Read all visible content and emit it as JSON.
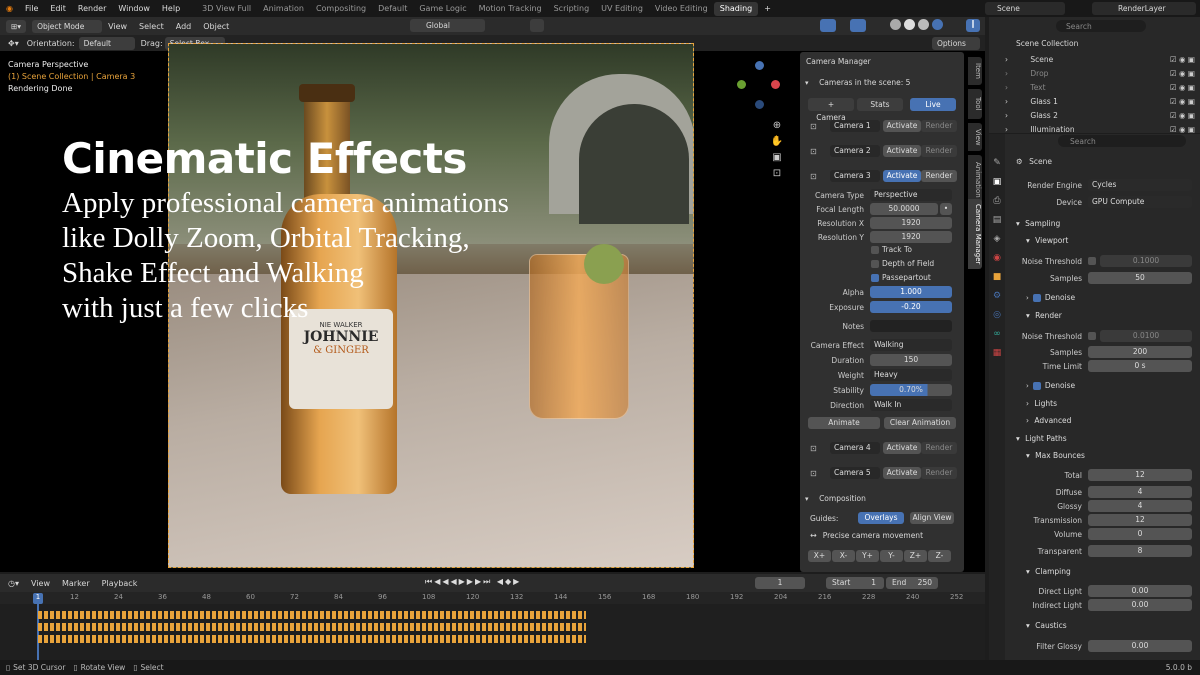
{
  "menu": {
    "items": [
      "File",
      "Edit",
      "Render",
      "Window",
      "Help"
    ],
    "workspaces": [
      "3D View Full",
      "Animation",
      "Compositing",
      "Default",
      "Game Logic",
      "Motion Tracking",
      "Scripting",
      "UV Editing",
      "Video Editing",
      "Shading"
    ],
    "scene": "Scene",
    "renderlayer": "RenderLayer"
  },
  "viewport_header": {
    "mode": "Object Mode",
    "menus": [
      "View",
      "Select",
      "Add",
      "Object"
    ],
    "transform": "Global",
    "orientation_label": "Orientation:",
    "orientation": "Default",
    "drag_label": "Drag:",
    "drag": "Select Box",
    "options": "Options"
  },
  "overlay_text": {
    "line1": "Camera Perspective",
    "line2": "(1) Scene Collection | Camera 3",
    "line3": "Rendering Done"
  },
  "promo": {
    "title": "Cinematic Effects",
    "lines": [
      "Apply professional camera animations",
      "like Dolly Zoom, Orbital Tracking,",
      "Shake Effect and Walking",
      "with just a few clicks"
    ]
  },
  "label_text": {
    "l1": "NIE WALKER",
    "l2": "JOHNNIE",
    "l3": "& GINGER"
  },
  "camera_manager": {
    "title": "Camera Manager",
    "cameras_header": "Cameras in the scene: 5",
    "add_camera": "+ Camera",
    "stats": "Stats",
    "live": "Live",
    "cameras": [
      {
        "name": "Camera 1",
        "activate": "Activate",
        "render": "Render"
      },
      {
        "name": "Camera 2",
        "activate": "Activate",
        "render": "Render"
      },
      {
        "name": "Camera 3",
        "activate": "Activate",
        "render": "Render"
      }
    ],
    "props": {
      "camera_type_l": "Camera Type",
      "camera_type": "Perspective",
      "focal_l": "Focal Length",
      "focal": "50.0000",
      "resx_l": "Resolution X",
      "resx": "1920",
      "resy_l": "Resolution Y",
      "resy": "1920",
      "track": "Track To",
      "dof": "Depth of Field",
      "passe": "Passepartout",
      "alpha_l": "Alpha",
      "alpha": "1.000",
      "exposure_l": "Exposure",
      "exposure": "-0.20",
      "notes_l": "Notes",
      "effect_l": "Camera Effect",
      "effect": "Walking",
      "duration_l": "Duration",
      "duration": "150",
      "weight_l": "Weight",
      "weight": "Heavy",
      "stability_l": "Stability",
      "stability": "0.70%",
      "direction_l": "Direction",
      "direction": "Walk In",
      "animate": "Animate",
      "clear": "Clear Animation"
    },
    "cameras2": [
      {
        "name": "Camera 4",
        "activate": "Activate",
        "render": "Render"
      },
      {
        "name": "Camera 5",
        "activate": "Activate",
        "render": "Render"
      }
    ],
    "composition": "Composition",
    "guides": "Guides:",
    "overlays": "Overlays",
    "align": "Align View",
    "precise": "Precise camera movement",
    "moves": [
      "X+",
      "X-",
      "Y+",
      "Y-",
      "Z+",
      "Z-"
    ]
  },
  "side_tabs": [
    "Item",
    "Tool",
    "View",
    "Animation",
    "Camera Manager"
  ],
  "outliner": {
    "search": "Search",
    "root": "Scene Collection",
    "items": [
      "Scene",
      "Drop",
      "Text",
      "Glass 1",
      "Glass 2",
      "Illumination"
    ]
  },
  "properties": {
    "search": "Search",
    "scene": "Scene",
    "render_engine_l": "Render Engine",
    "render_engine": "Cycles",
    "device_l": "Device",
    "device": "GPU Compute",
    "sampling": "Sampling",
    "viewport": "Viewport",
    "noise_l": "Noise Threshold",
    "noise_vp": "0.1000",
    "samples_l": "Samples",
    "samples_vp": "50",
    "denoise": "Denoise",
    "render": "Render",
    "noise_r": "0.0100",
    "samples_r": "200",
    "time_limit_l": "Time Limit",
    "time_limit": "0 s",
    "lights": "Lights",
    "advanced": "Advanced",
    "light_paths": "Light Paths",
    "max_bounces": "Max Bounces",
    "total_l": "Total",
    "total": "12",
    "diffuse_l": "Diffuse",
    "diffuse": "4",
    "glossy_l": "Glossy",
    "glossy": "4",
    "transmission_l": "Transmission",
    "transmission": "12",
    "volume_l": "Volume",
    "volume": "0",
    "transparent_l": "Transparent",
    "transparent": "8",
    "clamping": "Clamping",
    "direct_l": "Direct Light",
    "direct": "0.00",
    "indirect_l": "Indirect Light",
    "indirect": "0.00",
    "caustics": "Caustics",
    "filter_l": "Filter Glossy",
    "filter": "0.00"
  },
  "timeline": {
    "view": "View",
    "marker": "Marker",
    "playback": "Playback",
    "frame": "1",
    "start_l": "Start",
    "start": "1",
    "end_l": "End",
    "end": "250",
    "ticks": [
      "1",
      "12",
      "24",
      "36",
      "48",
      "60",
      "72",
      "84",
      "96",
      "108",
      "120",
      "132",
      "144",
      "156",
      "168",
      "180",
      "192",
      "204",
      "216",
      "228",
      "240",
      "252"
    ]
  },
  "status": {
    "set_cursor": "Set 3D Cursor",
    "rotate": "Rotate View",
    "select": "Select",
    "version": "5.0.0 b"
  },
  "colors": {
    "accent": "#4772b3",
    "orange": "#e8a33b",
    "bg": "#1d1d1d"
  }
}
